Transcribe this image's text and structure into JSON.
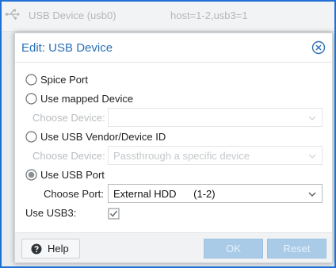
{
  "background_row": {
    "name": "USB Device (usb0)",
    "value": "host=1-2,usb3=1"
  },
  "dialog": {
    "title": "Edit: USB Device",
    "options": [
      {
        "label": "Spice Port",
        "selected": false
      },
      {
        "label": "Use mapped Device",
        "selected": false,
        "field_label": "Choose Device:",
        "field_value": ""
      },
      {
        "label": "Use USB Vendor/Device ID",
        "selected": false,
        "field_label": "Choose Device:",
        "field_value": "Passthrough a specific device"
      },
      {
        "label": "Use USB Port",
        "selected": true,
        "field_label": "Choose Port:",
        "field_value": "External HDD      (1-2)"
      }
    ],
    "usb3": {
      "label": "Use USB3:",
      "checked": true
    }
  },
  "footer": {
    "help_label": "Help",
    "ok_label": "OK",
    "reset_label": "Reset"
  },
  "colors": {
    "title": "#2a6fb5",
    "primary_button": "#a9cbe8",
    "frame": "#1f6fd4"
  }
}
